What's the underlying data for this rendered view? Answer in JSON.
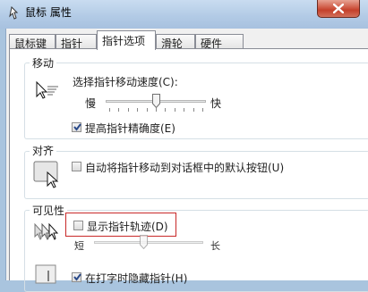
{
  "window": {
    "title": "鼠标 属性",
    "icon": "mouse-app-icon",
    "close_icon": "close-icon"
  },
  "tabs": [
    {
      "label": "鼠标键",
      "active": false
    },
    {
      "label": "指针",
      "active": false
    },
    {
      "label": "指针选项",
      "active": true
    },
    {
      "label": "滑轮",
      "active": false
    },
    {
      "label": "硬件",
      "active": false
    }
  ],
  "motion": {
    "group_title": "移动",
    "speed_label": "选择指针移动速度(C):",
    "slow": "慢",
    "fast": "快",
    "speed_level": 0.5,
    "precision_label": "提高指针精确度(E)",
    "precision_checked": true
  },
  "snap": {
    "group_title": "对齐",
    "snap_label": "自动将指针移动到对话框中的默认按钮(U)",
    "snap_checked": false
  },
  "visibility": {
    "group_title": "可见性",
    "trails_label": "显示指针轨迹(D)",
    "trails_checked": false,
    "short": "短",
    "long": "长",
    "trail_level": 0.45,
    "hide_label": "在打字时隐藏指针(H)",
    "hide_checked": true
  },
  "colors": {
    "highlight": "#c82828",
    "title_bar": "#b3cbe6"
  }
}
